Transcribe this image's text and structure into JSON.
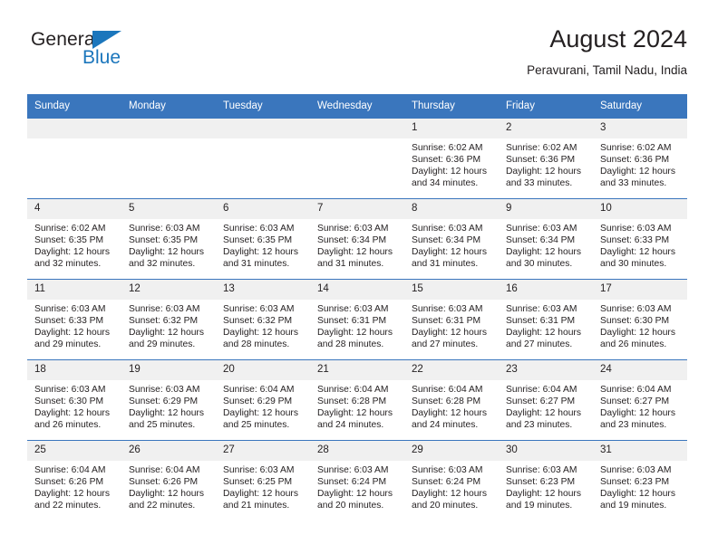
{
  "brand": {
    "name_part1": "General",
    "name_part2": "Blue",
    "accent_color": "#1b76bc",
    "triangle_icon": "triangle-icon"
  },
  "header": {
    "title": "August 2024",
    "subtitle": "Peravurani, Tamil Nadu, India"
  },
  "theme": {
    "header_bg": "#3a76bd",
    "daynum_bg": "#f0f0f0",
    "text": "#231f20"
  },
  "weekday_headers": [
    "Sunday",
    "Monday",
    "Tuesday",
    "Wednesday",
    "Thursday",
    "Friday",
    "Saturday"
  ],
  "labels": {
    "sunrise_prefix": "Sunrise:",
    "sunset_prefix": "Sunset:",
    "daylight_prefix": "Daylight:"
  },
  "weeks": [
    [
      {
        "day": "",
        "sunrise": "",
        "sunset": "",
        "daylight_line1": "",
        "daylight_line2": ""
      },
      {
        "day": "",
        "sunrise": "",
        "sunset": "",
        "daylight_line1": "",
        "daylight_line2": ""
      },
      {
        "day": "",
        "sunrise": "",
        "sunset": "",
        "daylight_line1": "",
        "daylight_line2": ""
      },
      {
        "day": "",
        "sunrise": "",
        "sunset": "",
        "daylight_line1": "",
        "daylight_line2": ""
      },
      {
        "day": "1",
        "sunrise": "Sunrise: 6:02 AM",
        "sunset": "Sunset: 6:36 PM",
        "daylight_line1": "Daylight: 12 hours",
        "daylight_line2": "and 34 minutes."
      },
      {
        "day": "2",
        "sunrise": "Sunrise: 6:02 AM",
        "sunset": "Sunset: 6:36 PM",
        "daylight_line1": "Daylight: 12 hours",
        "daylight_line2": "and 33 minutes."
      },
      {
        "day": "3",
        "sunrise": "Sunrise: 6:02 AM",
        "sunset": "Sunset: 6:36 PM",
        "daylight_line1": "Daylight: 12 hours",
        "daylight_line2": "and 33 minutes."
      }
    ],
    [
      {
        "day": "4",
        "sunrise": "Sunrise: 6:02 AM",
        "sunset": "Sunset: 6:35 PM",
        "daylight_line1": "Daylight: 12 hours",
        "daylight_line2": "and 32 minutes."
      },
      {
        "day": "5",
        "sunrise": "Sunrise: 6:03 AM",
        "sunset": "Sunset: 6:35 PM",
        "daylight_line1": "Daylight: 12 hours",
        "daylight_line2": "and 32 minutes."
      },
      {
        "day": "6",
        "sunrise": "Sunrise: 6:03 AM",
        "sunset": "Sunset: 6:35 PM",
        "daylight_line1": "Daylight: 12 hours",
        "daylight_line2": "and 31 minutes."
      },
      {
        "day": "7",
        "sunrise": "Sunrise: 6:03 AM",
        "sunset": "Sunset: 6:34 PM",
        "daylight_line1": "Daylight: 12 hours",
        "daylight_line2": "and 31 minutes."
      },
      {
        "day": "8",
        "sunrise": "Sunrise: 6:03 AM",
        "sunset": "Sunset: 6:34 PM",
        "daylight_line1": "Daylight: 12 hours",
        "daylight_line2": "and 31 minutes."
      },
      {
        "day": "9",
        "sunrise": "Sunrise: 6:03 AM",
        "sunset": "Sunset: 6:34 PM",
        "daylight_line1": "Daylight: 12 hours",
        "daylight_line2": "and 30 minutes."
      },
      {
        "day": "10",
        "sunrise": "Sunrise: 6:03 AM",
        "sunset": "Sunset: 6:33 PM",
        "daylight_line1": "Daylight: 12 hours",
        "daylight_line2": "and 30 minutes."
      }
    ],
    [
      {
        "day": "11",
        "sunrise": "Sunrise: 6:03 AM",
        "sunset": "Sunset: 6:33 PM",
        "daylight_line1": "Daylight: 12 hours",
        "daylight_line2": "and 29 minutes."
      },
      {
        "day": "12",
        "sunrise": "Sunrise: 6:03 AM",
        "sunset": "Sunset: 6:32 PM",
        "daylight_line1": "Daylight: 12 hours",
        "daylight_line2": "and 29 minutes."
      },
      {
        "day": "13",
        "sunrise": "Sunrise: 6:03 AM",
        "sunset": "Sunset: 6:32 PM",
        "daylight_line1": "Daylight: 12 hours",
        "daylight_line2": "and 28 minutes."
      },
      {
        "day": "14",
        "sunrise": "Sunrise: 6:03 AM",
        "sunset": "Sunset: 6:31 PM",
        "daylight_line1": "Daylight: 12 hours",
        "daylight_line2": "and 28 minutes."
      },
      {
        "day": "15",
        "sunrise": "Sunrise: 6:03 AM",
        "sunset": "Sunset: 6:31 PM",
        "daylight_line1": "Daylight: 12 hours",
        "daylight_line2": "and 27 minutes."
      },
      {
        "day": "16",
        "sunrise": "Sunrise: 6:03 AM",
        "sunset": "Sunset: 6:31 PM",
        "daylight_line1": "Daylight: 12 hours",
        "daylight_line2": "and 27 minutes."
      },
      {
        "day": "17",
        "sunrise": "Sunrise: 6:03 AM",
        "sunset": "Sunset: 6:30 PM",
        "daylight_line1": "Daylight: 12 hours",
        "daylight_line2": "and 26 minutes."
      }
    ],
    [
      {
        "day": "18",
        "sunrise": "Sunrise: 6:03 AM",
        "sunset": "Sunset: 6:30 PM",
        "daylight_line1": "Daylight: 12 hours",
        "daylight_line2": "and 26 minutes."
      },
      {
        "day": "19",
        "sunrise": "Sunrise: 6:03 AM",
        "sunset": "Sunset: 6:29 PM",
        "daylight_line1": "Daylight: 12 hours",
        "daylight_line2": "and 25 minutes."
      },
      {
        "day": "20",
        "sunrise": "Sunrise: 6:04 AM",
        "sunset": "Sunset: 6:29 PM",
        "daylight_line1": "Daylight: 12 hours",
        "daylight_line2": "and 25 minutes."
      },
      {
        "day": "21",
        "sunrise": "Sunrise: 6:04 AM",
        "sunset": "Sunset: 6:28 PM",
        "daylight_line1": "Daylight: 12 hours",
        "daylight_line2": "and 24 minutes."
      },
      {
        "day": "22",
        "sunrise": "Sunrise: 6:04 AM",
        "sunset": "Sunset: 6:28 PM",
        "daylight_line1": "Daylight: 12 hours",
        "daylight_line2": "and 24 minutes."
      },
      {
        "day": "23",
        "sunrise": "Sunrise: 6:04 AM",
        "sunset": "Sunset: 6:27 PM",
        "daylight_line1": "Daylight: 12 hours",
        "daylight_line2": "and 23 minutes."
      },
      {
        "day": "24",
        "sunrise": "Sunrise: 6:04 AM",
        "sunset": "Sunset: 6:27 PM",
        "daylight_line1": "Daylight: 12 hours",
        "daylight_line2": "and 23 minutes."
      }
    ],
    [
      {
        "day": "25",
        "sunrise": "Sunrise: 6:04 AM",
        "sunset": "Sunset: 6:26 PM",
        "daylight_line1": "Daylight: 12 hours",
        "daylight_line2": "and 22 minutes."
      },
      {
        "day": "26",
        "sunrise": "Sunrise: 6:04 AM",
        "sunset": "Sunset: 6:26 PM",
        "daylight_line1": "Daylight: 12 hours",
        "daylight_line2": "and 22 minutes."
      },
      {
        "day": "27",
        "sunrise": "Sunrise: 6:03 AM",
        "sunset": "Sunset: 6:25 PM",
        "daylight_line1": "Daylight: 12 hours",
        "daylight_line2": "and 21 minutes."
      },
      {
        "day": "28",
        "sunrise": "Sunrise: 6:03 AM",
        "sunset": "Sunset: 6:24 PM",
        "daylight_line1": "Daylight: 12 hours",
        "daylight_line2": "and 20 minutes."
      },
      {
        "day": "29",
        "sunrise": "Sunrise: 6:03 AM",
        "sunset": "Sunset: 6:24 PM",
        "daylight_line1": "Daylight: 12 hours",
        "daylight_line2": "and 20 minutes."
      },
      {
        "day": "30",
        "sunrise": "Sunrise: 6:03 AM",
        "sunset": "Sunset: 6:23 PM",
        "daylight_line1": "Daylight: 12 hours",
        "daylight_line2": "and 19 minutes."
      },
      {
        "day": "31",
        "sunrise": "Sunrise: 6:03 AM",
        "sunset": "Sunset: 6:23 PM",
        "daylight_line1": "Daylight: 12 hours",
        "daylight_line2": "and 19 minutes."
      }
    ]
  ]
}
